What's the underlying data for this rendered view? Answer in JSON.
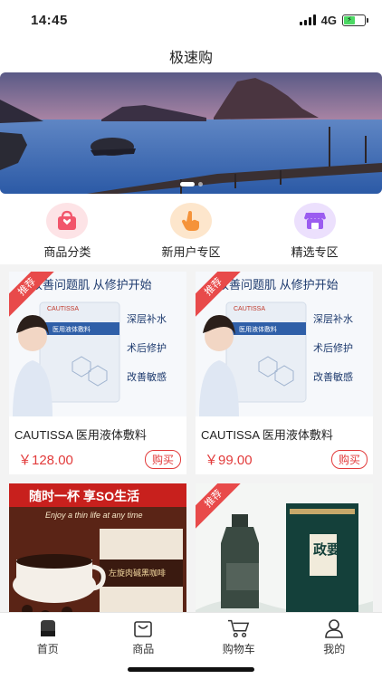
{
  "status_bar": {
    "time": "14:45",
    "network": "4G"
  },
  "header": {
    "title": "极速购"
  },
  "banner": {
    "slides": 2,
    "active_index": 0
  },
  "categories": [
    {
      "label": "商品分类",
      "icon": "gift-bag-icon",
      "color": "#f2556b"
    },
    {
      "label": "新用户专区",
      "icon": "hand-tap-icon",
      "color": "#f5933a"
    },
    {
      "label": "精选专区",
      "icon": "store-icon",
      "color": "#9b5cf0"
    }
  ],
  "products": [
    {
      "badge": "推荐",
      "headline": "改善问题肌 从修护开始",
      "brand": "CAUTISSA",
      "pack_label": "医用液体敷料",
      "features": [
        "深层补水",
        "术后修护",
        "改善敏感"
      ],
      "name": "CAUTISSA 医用液体敷料",
      "price": "￥128.00",
      "buy_label": "购买"
    },
    {
      "badge": "推荐",
      "headline": "改善问题肌 从修护开始",
      "brand": "CAUTISSA",
      "pack_label": "医用液体敷料",
      "features": [
        "深层补水",
        "术后修护",
        "改善敏感"
      ],
      "name": "CAUTISSA 医用液体敷料",
      "price": "￥99.00",
      "buy_label": "购买"
    },
    {
      "headline": "随时一杯 享SO生活",
      "subline": "Enjoy a thin life at any time",
      "pack_label": "左旋肉碱黑咖啡"
    },
    {
      "badge": "推荐",
      "pack_label": "政要"
    }
  ],
  "tabbar": {
    "items": [
      {
        "label": "首页",
        "icon": "home-icon",
        "active": true
      },
      {
        "label": "商品",
        "icon": "bag-icon",
        "active": false
      },
      {
        "label": "购物车",
        "icon": "cart-icon",
        "active": false
      },
      {
        "label": "我的",
        "icon": "user-icon",
        "active": false
      }
    ]
  },
  "colors": {
    "accent": "#e23b3b",
    "ribbon": "#e84a4a"
  }
}
